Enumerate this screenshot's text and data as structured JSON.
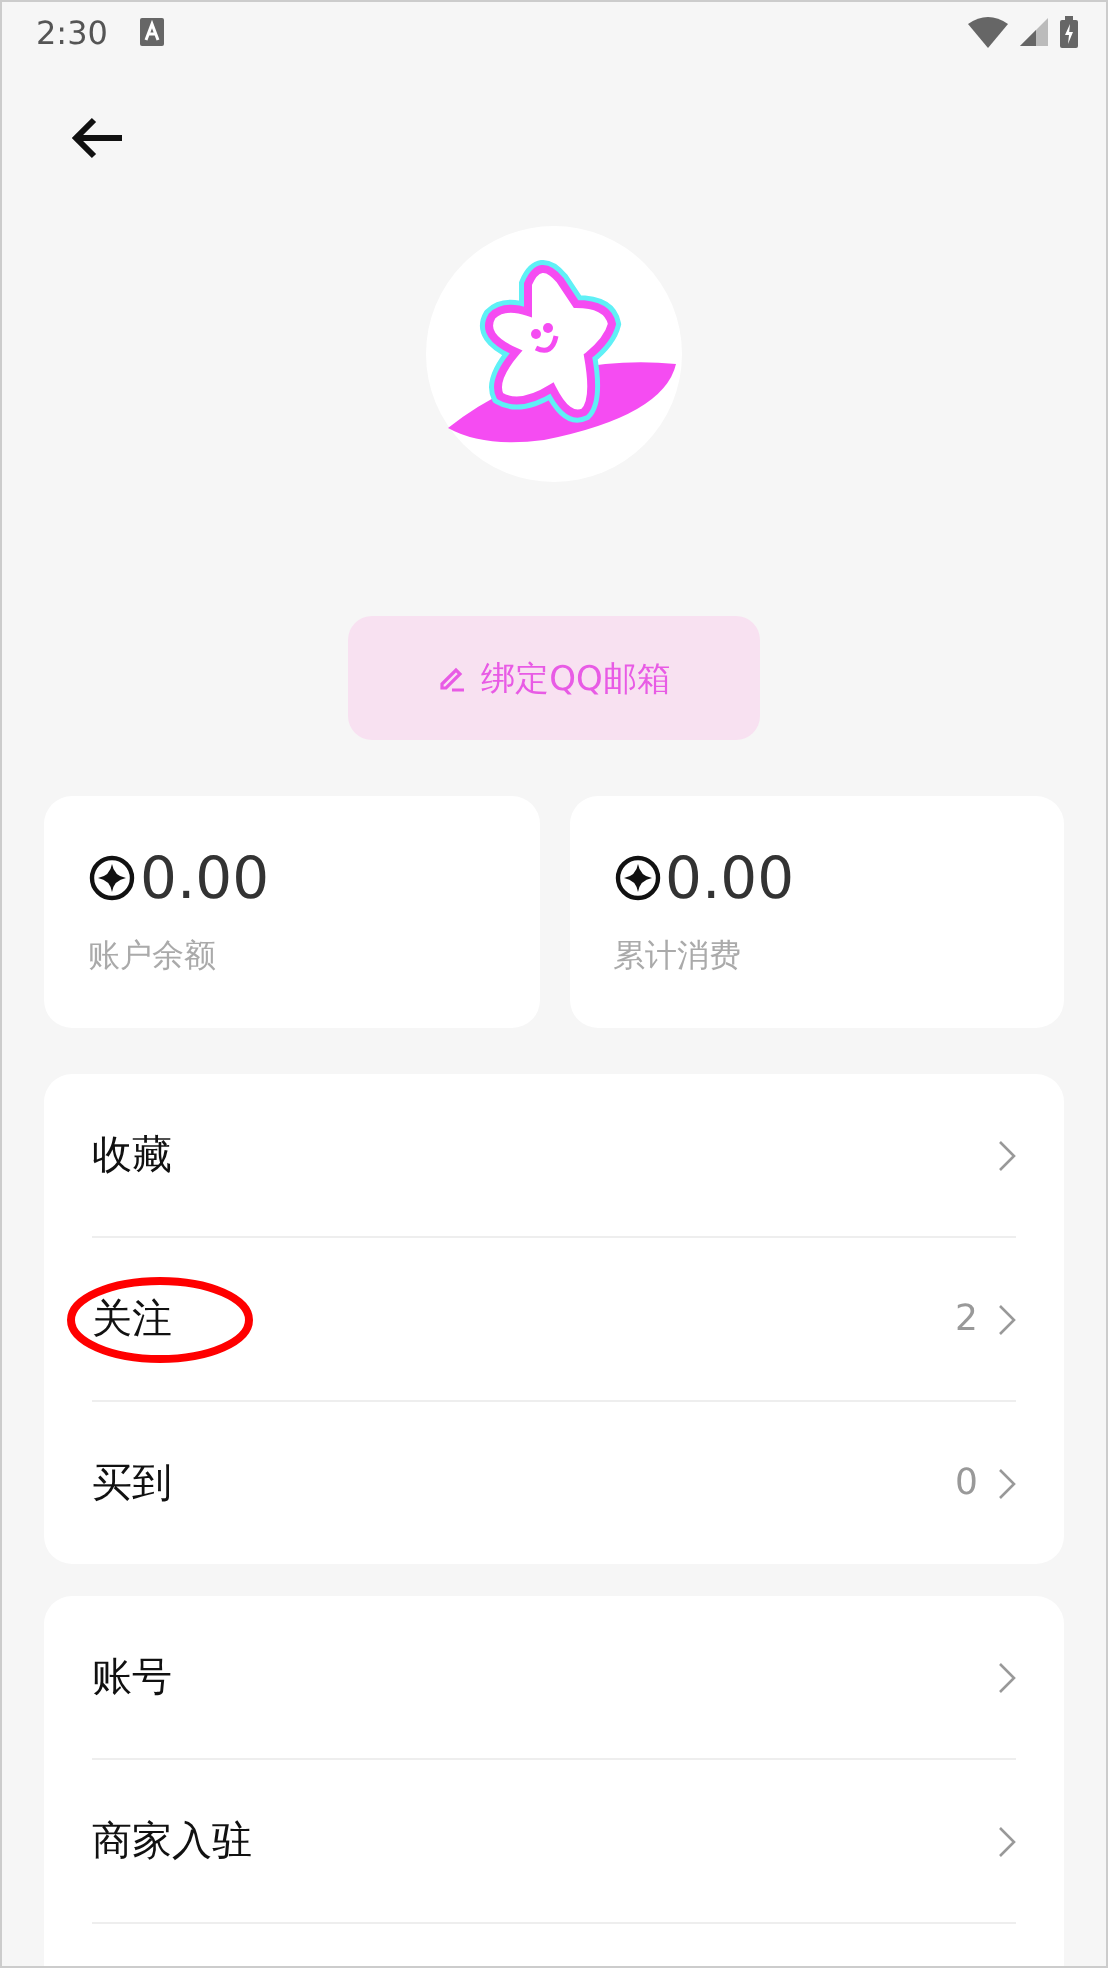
{
  "status_bar": {
    "time": "2:30"
  },
  "bind_button": {
    "label": "绑定QQ邮箱"
  },
  "stats": [
    {
      "value": "0.00",
      "label": "账户余额"
    },
    {
      "value": "0.00",
      "label": "累计消费"
    }
  ],
  "menu_groups": [
    {
      "items": [
        {
          "label": "收藏",
          "highlighted": false
        },
        {
          "label": "关注",
          "count": "2",
          "highlighted": true
        },
        {
          "label": "买到",
          "count": "0",
          "highlighted": false
        }
      ]
    },
    {
      "items": [
        {
          "label": "账号",
          "highlighted": false
        },
        {
          "label": "商家入驻",
          "highlighted": false
        }
      ]
    }
  ]
}
